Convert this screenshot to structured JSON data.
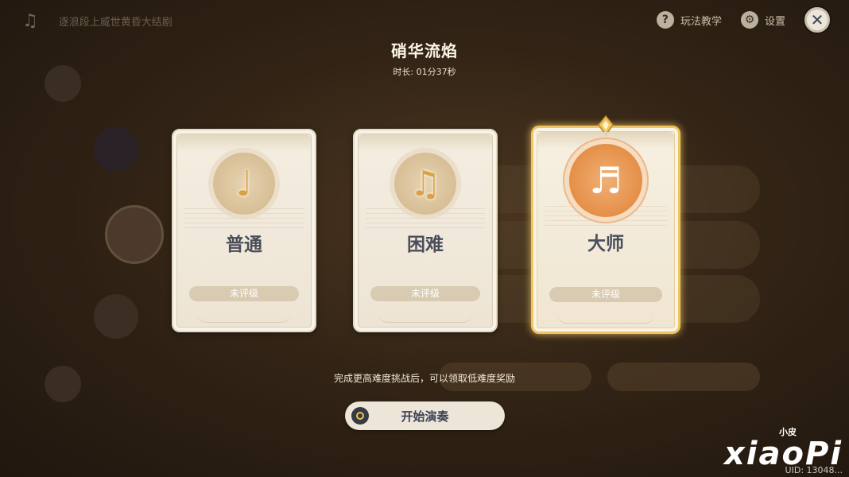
{
  "top_bar": {
    "event_title": "逐浪段上威世黄昏大结剧",
    "tutorial_label": "玩法教学",
    "settings_label": "设置",
    "icons": [
      "music-note-icon",
      "help-icon",
      "gear-icon",
      "close-icon"
    ]
  },
  "song": {
    "title": "硝华流焰",
    "duration": "时长: 01分37秒"
  },
  "difficulties": [
    {
      "name": "普通",
      "rank": "未评级",
      "glyph": "♩",
      "selected": false
    },
    {
      "name": "困难",
      "rank": "未评级",
      "glyph": "♫",
      "selected": false
    },
    {
      "name": "大师",
      "rank": "未评级",
      "glyph": "♬",
      "selected": true
    }
  ],
  "reward_hint": "完成更高难度挑战后，可以领取低难度奖励",
  "start_button": {
    "label": "开始演奏"
  },
  "watermark": {
    "small": "小皮",
    "big": "xiaoPi",
    "uid": "UID: 13048..."
  },
  "colors": {
    "selected_border": "#f0c560",
    "selected_emblem": "#e58f48",
    "card_bg": "#f4ede1",
    "text_dark": "#4a4e5a"
  }
}
